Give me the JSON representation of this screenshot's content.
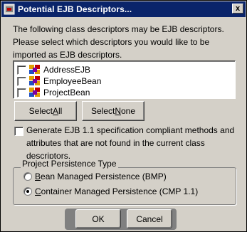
{
  "window": {
    "title": "Potential EJB Descriptors...",
    "close_symbol": "x"
  },
  "description": "The following class descriptors may be EJB descriptors. Please select which descriptors you would like to be imported as EJB descriptors.",
  "list": {
    "items": [
      {
        "label": "AddressEJB",
        "checked": false,
        "icon": "bean-icon"
      },
      {
        "label": "EmployeeBean",
        "checked": false,
        "icon": "bean-icon"
      },
      {
        "label": "ProjectBean",
        "checked": false,
        "icon": "bean-icon"
      }
    ]
  },
  "buttons": {
    "select_all": {
      "pre": "Select ",
      "accel": "A",
      "post": "ll"
    },
    "select_none": {
      "pre": "Select ",
      "accel": "N",
      "post": "one"
    },
    "ok": "OK",
    "cancel": "Cancel"
  },
  "generate_option": {
    "checked": false,
    "label": "Generate EJB 1.1 specification compliant methods and attributes that are not found in the current class descriptors."
  },
  "persistence": {
    "legend": "Project Persistence Type",
    "options": [
      {
        "accel": "B",
        "rest": "ean Managed Persistence (BMP)",
        "selected": false
      },
      {
        "accel": "C",
        "rest": "ontainer Managed Persistence (CMP 1.1)",
        "selected": true
      }
    ]
  },
  "colors": {
    "title_bar": "#0a246a",
    "face": "#d4d0c8"
  }
}
